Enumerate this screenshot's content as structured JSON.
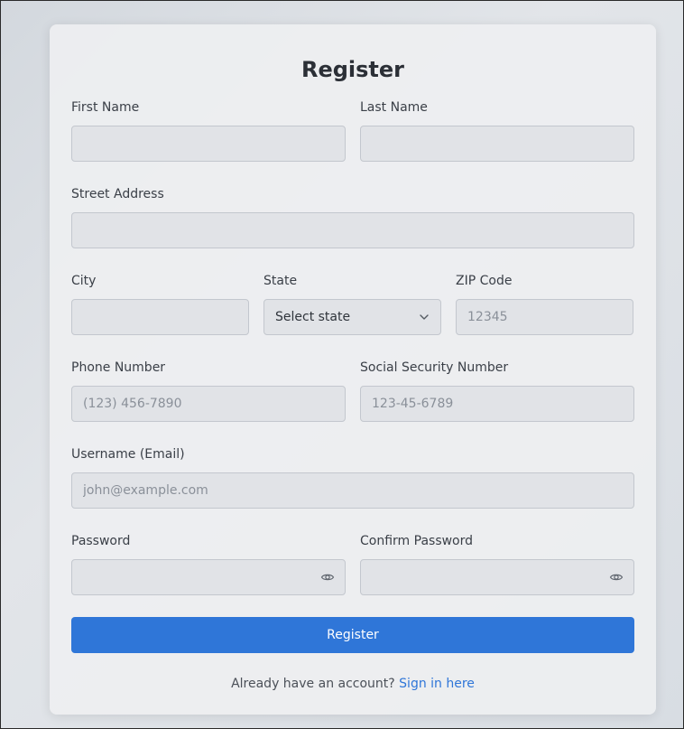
{
  "form": {
    "title": "Register",
    "first_name": {
      "label": "First Name",
      "value": "",
      "placeholder": ""
    },
    "last_name": {
      "label": "Last Name",
      "value": "",
      "placeholder": ""
    },
    "street": {
      "label": "Street Address",
      "value": "",
      "placeholder": ""
    },
    "city": {
      "label": "City",
      "value": "",
      "placeholder": ""
    },
    "state": {
      "label": "State",
      "selected": "Select state"
    },
    "zip": {
      "label": "ZIP Code",
      "value": "",
      "placeholder": "12345"
    },
    "phone": {
      "label": "Phone Number",
      "value": "",
      "placeholder": "(123) 456-7890"
    },
    "ssn": {
      "label": "Social Security Number",
      "value": "",
      "placeholder": "123-45-6789"
    },
    "username": {
      "label": "Username (Email)",
      "value": "",
      "placeholder": "john@example.com"
    },
    "password": {
      "label": "Password",
      "value": "",
      "placeholder": ""
    },
    "confirm_password": {
      "label": "Confirm Password",
      "value": "",
      "placeholder": ""
    },
    "submit_label": "Register",
    "footer_text": "Already have an account?",
    "signin_link": "Sign in here"
  },
  "icons": {
    "state_chevron": "chevron-down-icon",
    "password_toggle": "eye-icon",
    "confirm_toggle": "eye-icon"
  },
  "colors": {
    "accent": "#2f76d8",
    "field_bg": "#e1e3e7",
    "field_border": "#c3c7ce",
    "text": "#2b2f36"
  }
}
